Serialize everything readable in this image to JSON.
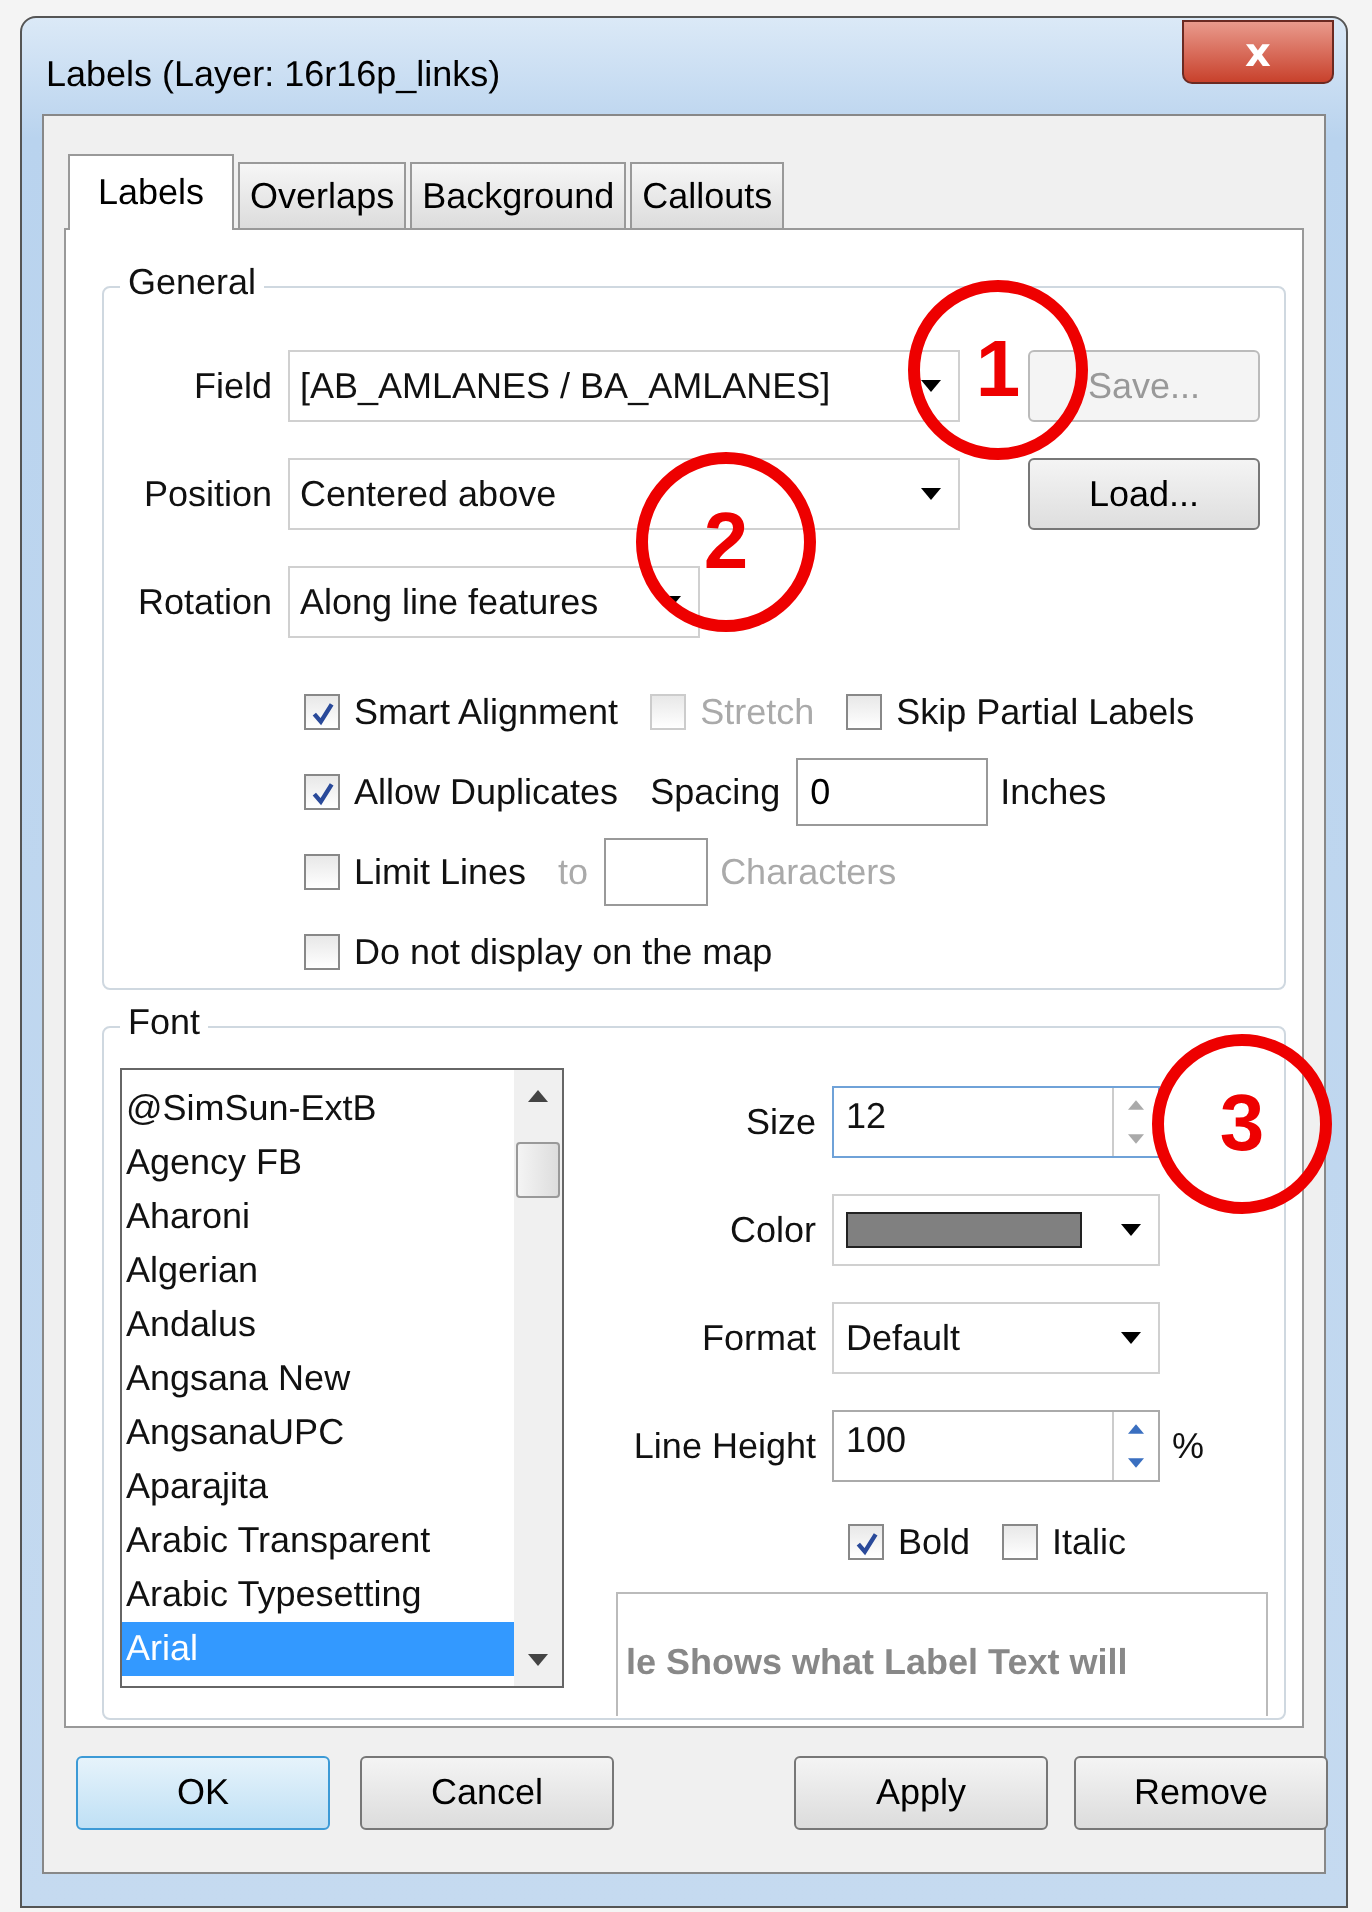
{
  "window": {
    "title": "Labels (Layer: 16r16p_links)",
    "close": "x"
  },
  "tabs": [
    {
      "label": "Labels",
      "selected": true
    },
    {
      "label": "Overlaps",
      "selected": false
    },
    {
      "label": "Background",
      "selected": false
    },
    {
      "label": "Callouts",
      "selected": false
    }
  ],
  "general": {
    "title": "General",
    "field": {
      "label": "Field",
      "value": "[AB_AMLANES / BA_AMLANES]"
    },
    "position": {
      "label": "Position",
      "value": "Centered above"
    },
    "rotation": {
      "label": "Rotation",
      "value": "Along line features"
    },
    "save_button": {
      "label": "Save...",
      "disabled": true
    },
    "load_button": {
      "label": "Load...",
      "disabled": false
    },
    "smart_alignment": {
      "label": "Smart Alignment",
      "checked": true,
      "disabled": false
    },
    "stretch": {
      "label": "Stretch",
      "checked": false,
      "disabled": true
    },
    "skip_partial": {
      "label": "Skip Partial Labels",
      "checked": false,
      "disabled": false
    },
    "allow_duplicates": {
      "label": "Allow Duplicates",
      "checked": true,
      "disabled": false
    },
    "spacing": {
      "label": "Spacing",
      "value": "0",
      "unit": "Inches"
    },
    "limit_lines": {
      "label": "Limit Lines",
      "checked": false,
      "disabled": false
    },
    "limit_to": {
      "label": "to",
      "unit": "Characters",
      "disabled": true
    },
    "do_not_display": {
      "label": "Do not display on the map",
      "checked": false,
      "disabled": false
    }
  },
  "font": {
    "title": "Font",
    "list": [
      {
        "label": "@SimSun-ExtB",
        "selected": false
      },
      {
        "label": "Agency FB",
        "selected": false
      },
      {
        "label": "Aharoni",
        "selected": false
      },
      {
        "label": "Algerian",
        "selected": false
      },
      {
        "label": "Andalus",
        "selected": false
      },
      {
        "label": "Angsana New",
        "selected": false
      },
      {
        "label": "AngsanaUPC",
        "selected": false
      },
      {
        "label": "Aparajita",
        "selected": false
      },
      {
        "label": "Arabic Transparent",
        "selected": false
      },
      {
        "label": "Arabic Typesetting",
        "selected": false
      },
      {
        "label": "Arial",
        "selected": true
      }
    ],
    "size": {
      "label": "Size",
      "value": "12"
    },
    "color": {
      "label": "Color"
    },
    "format": {
      "label": "Format",
      "value": "Default"
    },
    "line_height": {
      "label": "Line Height",
      "value": "100",
      "unit": "%"
    },
    "bold": {
      "label": "Bold",
      "checked": true
    },
    "italic": {
      "label": "Italic",
      "checked": false
    },
    "preview": "le Shows what Label Text will"
  },
  "buttons": [
    {
      "label": "OK",
      "default": true
    },
    {
      "label": "Cancel",
      "default": false
    },
    {
      "label": "Apply",
      "default": false
    },
    {
      "label": "Remove",
      "default": false
    }
  ],
  "annotations": [
    {
      "number": "1"
    },
    {
      "number": "2"
    },
    {
      "number": "3"
    }
  ]
}
